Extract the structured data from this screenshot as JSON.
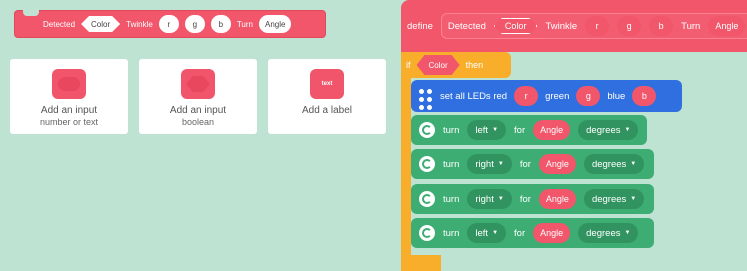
{
  "preview": {
    "label_detected": "Detected",
    "input_color": "Color",
    "label_twinkle": "Twinkle",
    "input_r": "r",
    "input_g": "g",
    "input_b": "b",
    "label_turn": "Turn",
    "input_angle": "Angle"
  },
  "cards": [
    {
      "icon": "number-or-text-icon",
      "line1": "Add an input",
      "line2": "number or text"
    },
    {
      "icon": "boolean-icon",
      "line1": "Add an input",
      "line2": "boolean"
    },
    {
      "icon": "label-icon",
      "icon_text": "text",
      "line1": "Add a label",
      "line2": ""
    }
  ],
  "script": {
    "define_label": "define",
    "def_detected": "Detected",
    "def_color": "Color",
    "def_twinkle": "Twinkle",
    "def_r": "r",
    "def_g": "g",
    "def_b": "b",
    "def_turn": "Turn",
    "def_angle": "Angle",
    "if_label": "if",
    "if_color": "Color",
    "then_label": "then",
    "led": {
      "text": "set all LEDs red",
      "r": "r",
      "green_label": "green",
      "g": "g",
      "blue_label": "blue",
      "b": "b"
    },
    "turns": [
      {
        "turn": "turn",
        "dir": "left",
        "for": "for",
        "angle": "Angle",
        "unit": "degrees"
      },
      {
        "turn": "turn",
        "dir": "right",
        "for": "for",
        "angle": "Angle",
        "unit": "degrees"
      },
      {
        "turn": "turn",
        "dir": "right",
        "for": "for",
        "angle": "Angle",
        "unit": "degrees"
      },
      {
        "turn": "turn",
        "dir": "left",
        "for": "for",
        "angle": "Angle",
        "unit": "degrees"
      }
    ]
  },
  "colors": {
    "background": "#bfe3d2",
    "myblock": "#f1566a",
    "control": "#f8ad2b",
    "lights": "#2f6fe0",
    "drive": "#3dad73"
  }
}
